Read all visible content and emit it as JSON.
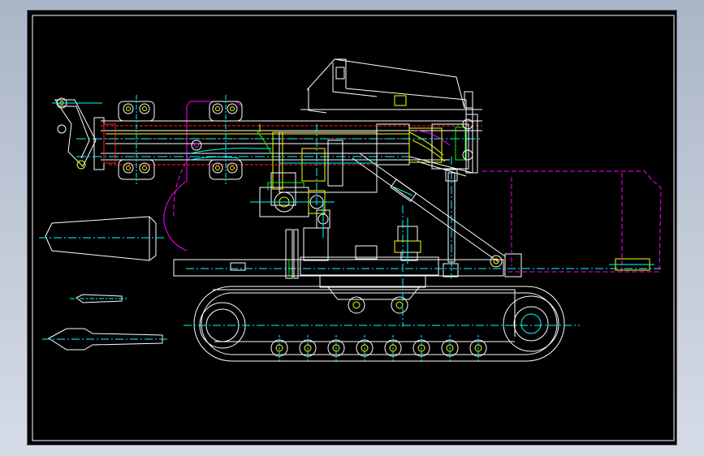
{
  "viewport": {
    "background": "#000000",
    "frame_color": "#ffffff"
  },
  "layers": {
    "outline": "#ffffff",
    "center": "#00ffff",
    "hidden": "#ff00ff",
    "hydraulic": "#ffff00",
    "section": "#ff2020",
    "green": "#00ff00"
  },
  "drawing": {
    "subject": "crawler-drill-rig-side-view",
    "text_labels": []
  }
}
